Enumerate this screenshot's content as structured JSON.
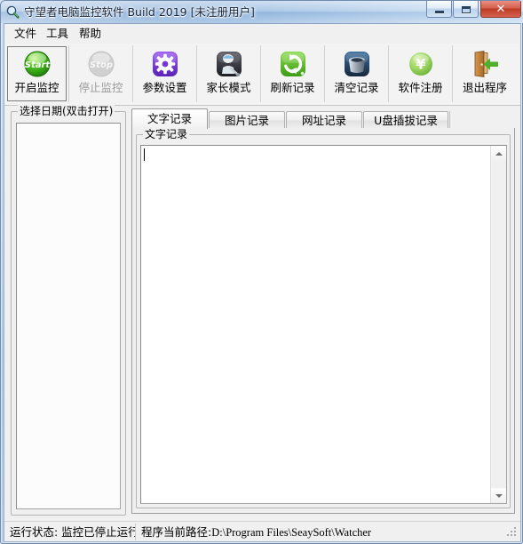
{
  "window": {
    "title": "守望者电脑监控软件  Build 2019    [未注册用户]",
    "icon": "magnifier-icon",
    "controls": {
      "minimize": "最小化",
      "maximize": "最大化",
      "close": "✕"
    }
  },
  "menubar": {
    "items": [
      {
        "label": "文件",
        "name": "menu-file"
      },
      {
        "label": "工具",
        "name": "menu-tools"
      },
      {
        "label": "帮助",
        "name": "menu-help"
      }
    ]
  },
  "toolbar": {
    "buttons": [
      {
        "label": "开启监控",
        "icon": "start-monitor-icon",
        "state": "focused",
        "disabled": false
      },
      {
        "label": "停止监控",
        "icon": "stop-monitor-icon",
        "state": "disabled",
        "disabled": true
      },
      {
        "label": "参数设置",
        "icon": "settings-gear-icon",
        "state": "normal",
        "disabled": false
      },
      {
        "label": "家长模式",
        "icon": "parent-mode-icon",
        "state": "normal",
        "disabled": false
      },
      {
        "label": "刷新记录",
        "icon": "refresh-icon",
        "state": "normal",
        "disabled": false
      },
      {
        "label": "清空记录",
        "icon": "trash-icon",
        "state": "normal",
        "disabled": false
      },
      {
        "label": "软件注册",
        "icon": "register-yen-icon",
        "state": "normal",
        "disabled": false
      },
      {
        "label": "退出程序",
        "icon": "exit-door-icon",
        "state": "normal",
        "disabled": false
      }
    ]
  },
  "left_panel": {
    "group_title": "选择日期(双击打开)",
    "list_items": []
  },
  "tabs": {
    "items": [
      {
        "label": "文字记录",
        "active": true
      },
      {
        "label": "图片记录",
        "active": false
      },
      {
        "label": "网址记录",
        "active": false
      },
      {
        "label": "U盘插拔记录",
        "active": false
      }
    ],
    "active_page": {
      "group_title": "文字记录",
      "content": ""
    }
  },
  "statusbar": {
    "status_text": "运行状态: 监控已停止运行",
    "path_label": "程序当前路径:",
    "path_value": "D:\\Program Files\\SeaySoft\\Watcher"
  },
  "colors": {
    "title_blue": "#8fb5de",
    "close_red": "#bc3c26",
    "accent_green": "#3aa81e",
    "accent_purple": "#7b3fd4",
    "client_bg": "#f0f0f0"
  }
}
